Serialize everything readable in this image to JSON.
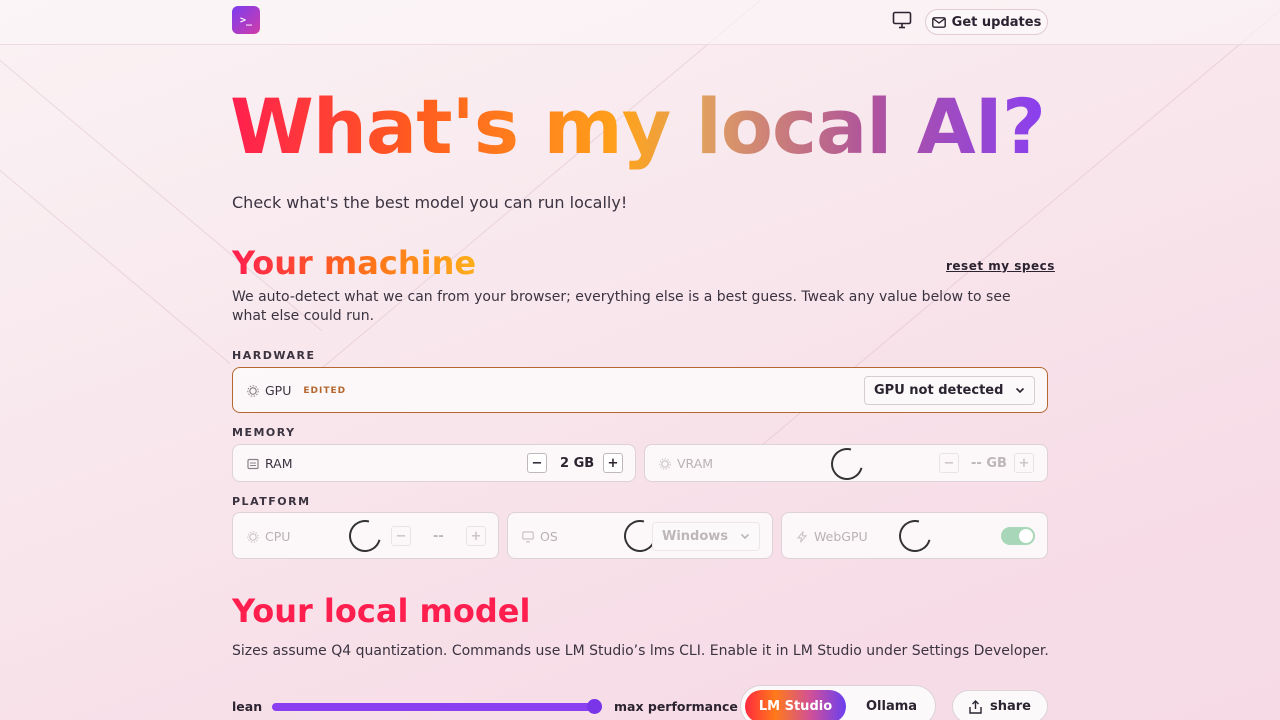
{
  "header": {
    "logo_text": ">_",
    "updates_label": "Get updates"
  },
  "hero": {
    "title": "What's my local AI?",
    "tagline": "Check what's the best model you can run locally!"
  },
  "machine": {
    "title": "Your machine",
    "reset_label": "reset my specs",
    "description": "We auto-detect what we can from your browser; everything else is a best guess. Tweak any value below to see what else could run.",
    "hardware": {
      "section": "HARDWARE",
      "gpu_label": "GPU",
      "gpu_badge": "EDITED",
      "gpu_value": "GPU not detected"
    },
    "memory": {
      "section": "MEMORY",
      "ram_label": "RAM",
      "ram_value": "2 GB",
      "vram_label": "VRAM",
      "vram_value": "-- GB"
    },
    "platform": {
      "section": "PLATFORM",
      "cpu_label": "CPU",
      "cpu_value": "--",
      "os_label": "OS",
      "os_value": "Windows",
      "webgpu_label": "WebGPU",
      "webgpu_enabled": true
    },
    "stepper": {
      "minus": "−",
      "plus": "+"
    }
  },
  "model": {
    "title": "Your local model",
    "description": "Sizes assume Q4 quantization. Commands use LM Studio’s lms CLI. Enable it in LM Studio under Settings    Developer.",
    "slider_min_label": "lean",
    "slider_max_label": "max performance",
    "slider_value": 1.0,
    "runtime_options": [
      "LM Studio",
      "Ollama"
    ],
    "runtime_selected": "LM Studio",
    "share_label": "share"
  },
  "colors": {
    "accent_red": "#ff1f4f",
    "accent_orange": "#ffa21a",
    "accent_purple": "#8a3ff0",
    "edited": "#b5672f"
  }
}
